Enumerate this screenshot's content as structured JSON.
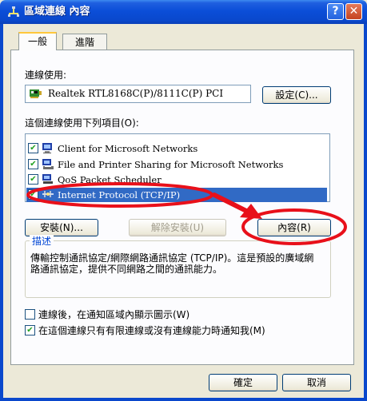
{
  "window": {
    "title": "區域連線 內容",
    "help_glyph": "?",
    "close_glyph": "✕",
    "chrome_color": "#0a48cc"
  },
  "tabs": [
    {
      "label": "一般",
      "selected": true
    },
    {
      "label": "進階",
      "selected": false
    }
  ],
  "general": {
    "connect_using_label": "連線使用:",
    "adapter_name": "Realtek RTL8168C(P)/8111C(P) PCI",
    "configure_button": "設定(C)...",
    "components_label": "這個連線使用下列項目(O):",
    "components": [
      {
        "name": "Client for Microsoft Networks",
        "checked": true,
        "icon": "network-client-icon"
      },
      {
        "name": "File and Printer Sharing for Microsoft Networks",
        "checked": true,
        "icon": "file-printer-sharing-icon"
      },
      {
        "name": "QoS Packet Scheduler",
        "checked": true,
        "icon": "qos-scheduler-icon"
      },
      {
        "name": "Internet Protocol (TCP/IP)",
        "checked": true,
        "selected": true,
        "icon": "protocol-icon"
      }
    ],
    "install_button": "安裝(N)...",
    "uninstall_button": "解除安裝(U)",
    "properties_button": "內容(R)",
    "description_title": "描述",
    "description_text": "傳輸控制通訊協定/網際網路通訊協定 (TCP/IP)。這是預設的廣域網路通訊協定，提供不同網路之間的通訊能力。",
    "show_icon_label": "連線後，在通知區域內顯示圖示(W)",
    "show_icon_checked": false,
    "notify_label": "在這個連線只有有限連線或沒有連線能力時通知我(M)",
    "notify_checked": true
  },
  "footer": {
    "ok_button": "確定",
    "cancel_button": "取消"
  },
  "annotation_color": "#e8101a",
  "selection_color": "#316ac5"
}
